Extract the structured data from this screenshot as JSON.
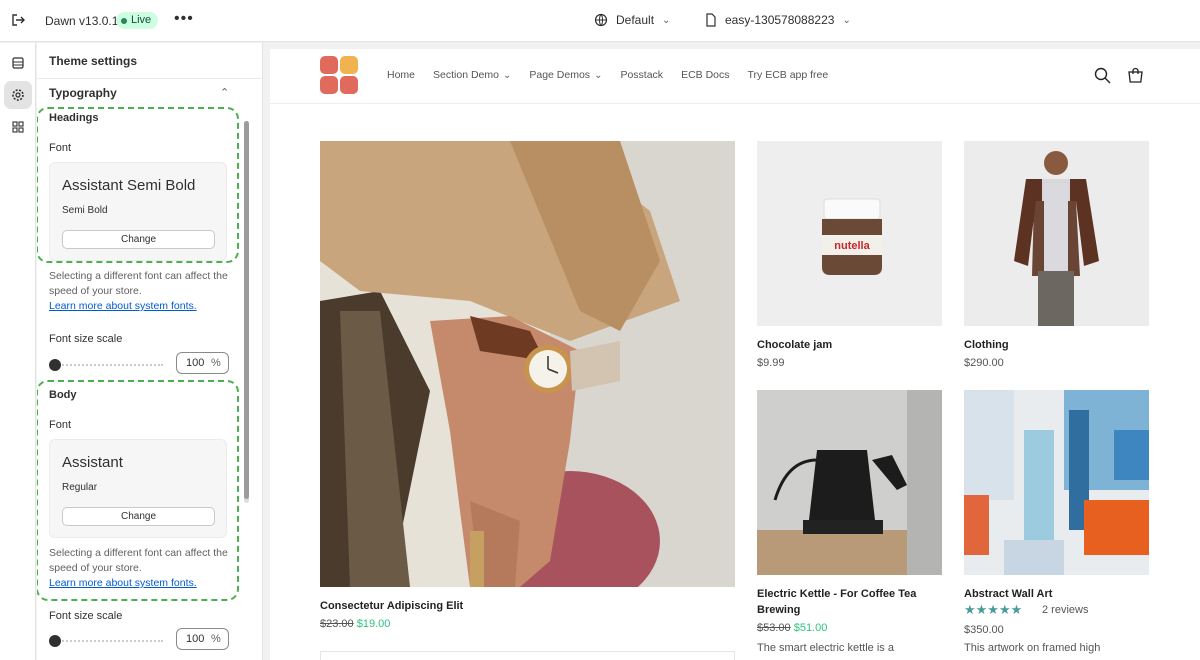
{
  "topbar": {
    "theme_name": "Dawn v13.0.1",
    "live_badge": "Live",
    "more": "•••",
    "preset": "Default",
    "page": "easy-130578088223"
  },
  "panel": {
    "title": "Theme settings",
    "group": "Typography",
    "headings": {
      "label": "Headings",
      "font_label": "Font",
      "font_name": "Assistant Semi Bold",
      "font_style": "Semi Bold",
      "change": "Change",
      "help": "Selecting a different font can affect the speed of your store.",
      "link": "Learn more about system fonts.",
      "scale_label": "Font size scale",
      "scale_value": "100",
      "scale_unit": "%"
    },
    "body": {
      "label": "Body",
      "font_label": "Font",
      "font_name": "Assistant",
      "font_style": "Regular",
      "change": "Change",
      "help": "Selecting a different font can affect the speed of your store.",
      "link": "Learn more about system fonts.",
      "scale_label": "Font size scale",
      "scale_value": "100",
      "scale_unit": "%"
    }
  },
  "store": {
    "nav": [
      "Home",
      "Section Demo",
      "Page Demos",
      "Posstack",
      "ECB Docs",
      "Try ECB app free"
    ],
    "products": {
      "featured": {
        "title": "Consectetur Adipiscing Elit",
        "old_price": "$23.00",
        "price": "$19.00"
      },
      "jam": {
        "title": "Chocolate jam",
        "price": "$9.99",
        "jar_label": "nutella"
      },
      "clothing": {
        "title": "Clothing",
        "price": "$290.00"
      },
      "kettle": {
        "title_1": "Electric Kettle - For Coffee Tea",
        "title_2": "Brewing",
        "old_price": "$53.00",
        "price": "$51.00",
        "desc": "The smart electric kettle is a"
      },
      "art": {
        "title": "Abstract Wall Art",
        "stars": "★★★★★",
        "reviews": "2 reviews",
        "price": "$350.00",
        "desc": "This artwork on framed high"
      }
    }
  },
  "colors": {
    "live_bg": "#cdfee1",
    "dash": "#4caf50",
    "sale": "#2ec27e",
    "link": "#005bd3"
  }
}
